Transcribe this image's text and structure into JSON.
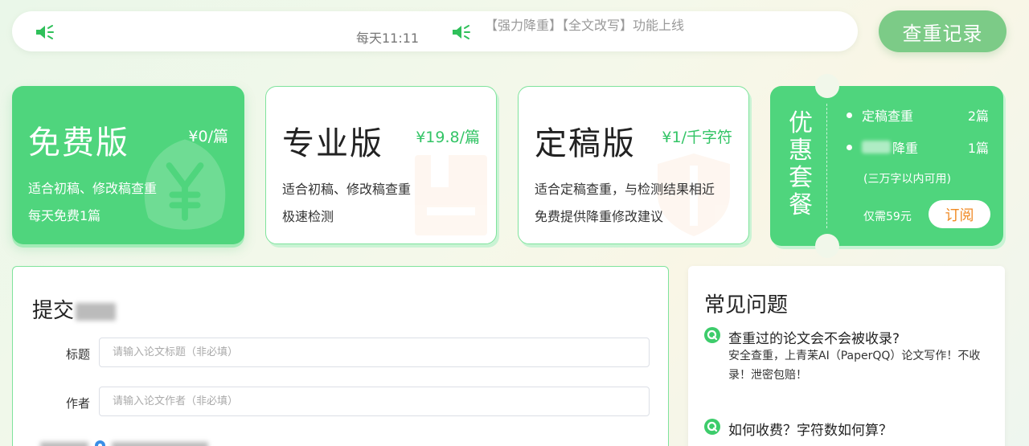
{
  "notice": {
    "time": "每天11:11",
    "message": "【强力降重】【全文改写】功能上线",
    "speaker_icon": "speaker-icon"
  },
  "record_button": "查重记录",
  "plans": {
    "free": {
      "title": "免费版",
      "price": "¥0/篇",
      "line1": "适合初稿、修改稿查重",
      "line2": "每天免费1篇"
    },
    "pro": {
      "title": "专业版",
      "price": "¥19.8/篇",
      "line1": "适合初稿、修改稿查重",
      "line2": "极速检测"
    },
    "final": {
      "title": "定稿版",
      "price": "¥1/千字符",
      "line1": "适合定稿查重，与检测结果相近",
      "line2": "免费提供降重修改建议"
    }
  },
  "combo": {
    "title": "优惠套餐",
    "item1_label": "定稿查重",
    "item1_count": "2篇",
    "item2_label": "降重",
    "item2_count": "1篇",
    "note": "(三万字以内可用)",
    "price": "仅需59元",
    "subscribe": "订阅"
  },
  "submit": {
    "title": "提交",
    "title_label": "标题",
    "title_placeholder": "请输入论文标题（非必填）",
    "author_label": "作者",
    "author_placeholder": "请输入论文作者（非必填）"
  },
  "faq": {
    "title": "常见问题",
    "items": [
      {
        "q": "查重过的论文会不会被收录?",
        "a": "安全查重，上青苿AI（PaperQQ）论文写作！不收录！泄密包赔！"
      },
      {
        "q": "如何收费？字符数如何算？",
        "a": ""
      }
    ]
  },
  "colors": {
    "brand_green": "#4fd57d",
    "button_green": "#7ccb87",
    "price_green": "#33c466",
    "subscribe_orange": "#f08a24"
  }
}
